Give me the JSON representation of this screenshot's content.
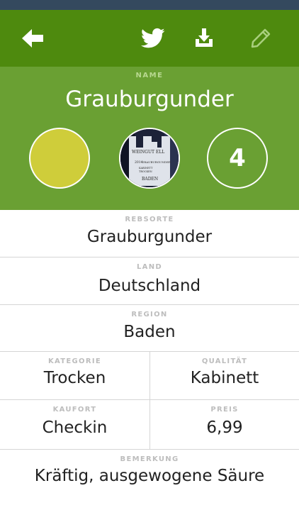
{
  "header": {
    "name_caption": "NAME",
    "wine_name": "Grauburgunder",
    "rating": "4",
    "swatch_color": "#cfcd3a"
  },
  "nav": {
    "back_icon": "arrow-left-icon",
    "share_icon": "twitter-icon",
    "download_icon": "download-tray-icon",
    "edit_icon": "pencil-icon"
  },
  "fields": {
    "rebsorte": {
      "label": "REBSORTE",
      "value": "Grauburgunder"
    },
    "land": {
      "label": "LAND",
      "value": "Deutschland"
    },
    "region": {
      "label": "REGION",
      "value": "Baden"
    },
    "kategorie": {
      "label": "KATEGORIE",
      "value": "Trocken"
    },
    "qualitaet": {
      "label": "QUALITÄT",
      "value": "Kabinett"
    },
    "kaufort": {
      "label": "KAUFORT",
      "value": "Checkin"
    },
    "preis": {
      "label": "PREIS",
      "value": "6,99"
    },
    "bemerkung": {
      "label": "BEMERKUNG",
      "value": "Kräftig, ausgewogene Säure"
    }
  },
  "photo_label_text": [
    "WEINGUT ELL",
    "2014",
    "GRAUBURGUNDER",
    "KABINETT",
    "TROCKEN",
    "BADEN"
  ],
  "colors": {
    "nav_green": "#4e8a0e",
    "header_green": "#6aa033",
    "status_bar": "#34495e"
  }
}
